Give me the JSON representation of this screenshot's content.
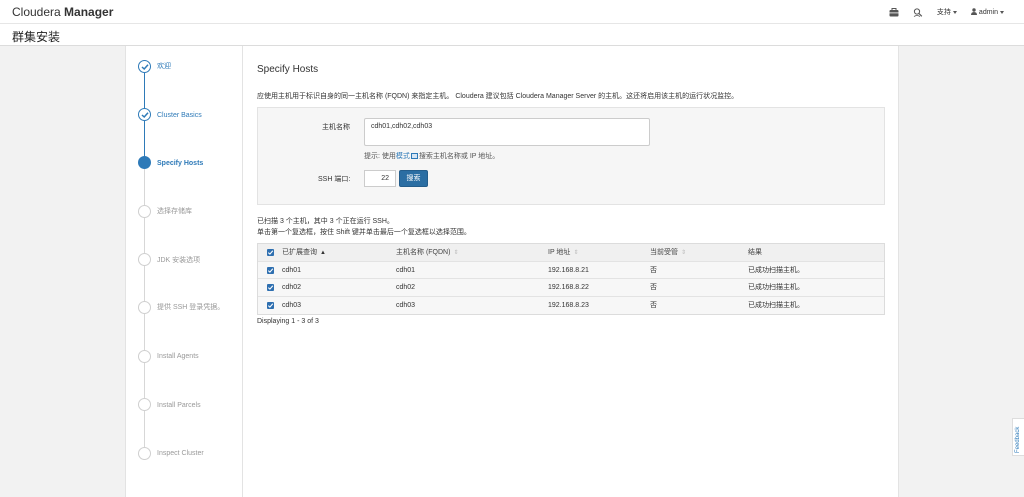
{
  "header": {
    "brand_light": "Cloudera ",
    "brand_bold": "Manager",
    "support_label": "支持",
    "user_label": "admin",
    "page_title": "群集安装"
  },
  "steps": [
    {
      "label": "欢迎",
      "state": "done"
    },
    {
      "label": "Cluster Basics",
      "state": "done"
    },
    {
      "label": "Specify Hosts",
      "state": "current"
    },
    {
      "label": "选择存储库",
      "state": "todo"
    },
    {
      "label": "JDK 安装选项",
      "state": "todo"
    },
    {
      "label": "提供 SSH 登录凭据。",
      "state": "todo"
    },
    {
      "label": "Install Agents",
      "state": "todo"
    },
    {
      "label": "Install Parcels",
      "state": "todo"
    },
    {
      "label": "Inspect Cluster",
      "state": "todo"
    }
  ],
  "main": {
    "title": "Specify Hosts",
    "description": "应使用主机用于标识自身的同一主机名称 (FQDN) 来指定主机。 Cloudera 建议包括 Cloudera Manager Server 的主机。这还将启用该主机的运行状况监控。",
    "host_label": "主机名称",
    "host_value": "cdh01,cdh02,cdh03",
    "hint_prefix": "提示: 使用",
    "hint_link": "模式",
    "hint_suffix": "搜索主机名称或 IP 地址。",
    "ssh_label": "SSH 端口:",
    "ssh_value": "22",
    "search_button": "搜索",
    "scan_summary": "已扫描 3 个主机，其中 3 个正在运行 SSH。",
    "scan_instructions": "单击第一个复选框，按住 Shift 键并单击最后一个复选框以选择范围。"
  },
  "table": {
    "headers": [
      "已扩展查询",
      "主机名称 (FQDN)",
      "IP 地址",
      "当前受管",
      "结果"
    ],
    "rows": [
      {
        "expanded": "cdh01",
        "fqdn": "cdh01",
        "ip": "192.168.8.21",
        "managed": "否",
        "result": "已成功扫描主机。"
      },
      {
        "expanded": "cdh02",
        "fqdn": "cdh02",
        "ip": "192.168.8.22",
        "managed": "否",
        "result": "已成功扫描主机。"
      },
      {
        "expanded": "cdh03",
        "fqdn": "cdh03",
        "ip": "192.168.8.23",
        "managed": "否",
        "result": "已成功扫描主机。"
      }
    ],
    "footer": "Displaying 1 - 3 of 3"
  },
  "feedback_label": "Feedback",
  "colors": {
    "accent": "#2e7ab8",
    "button": "#2b6ea3"
  }
}
